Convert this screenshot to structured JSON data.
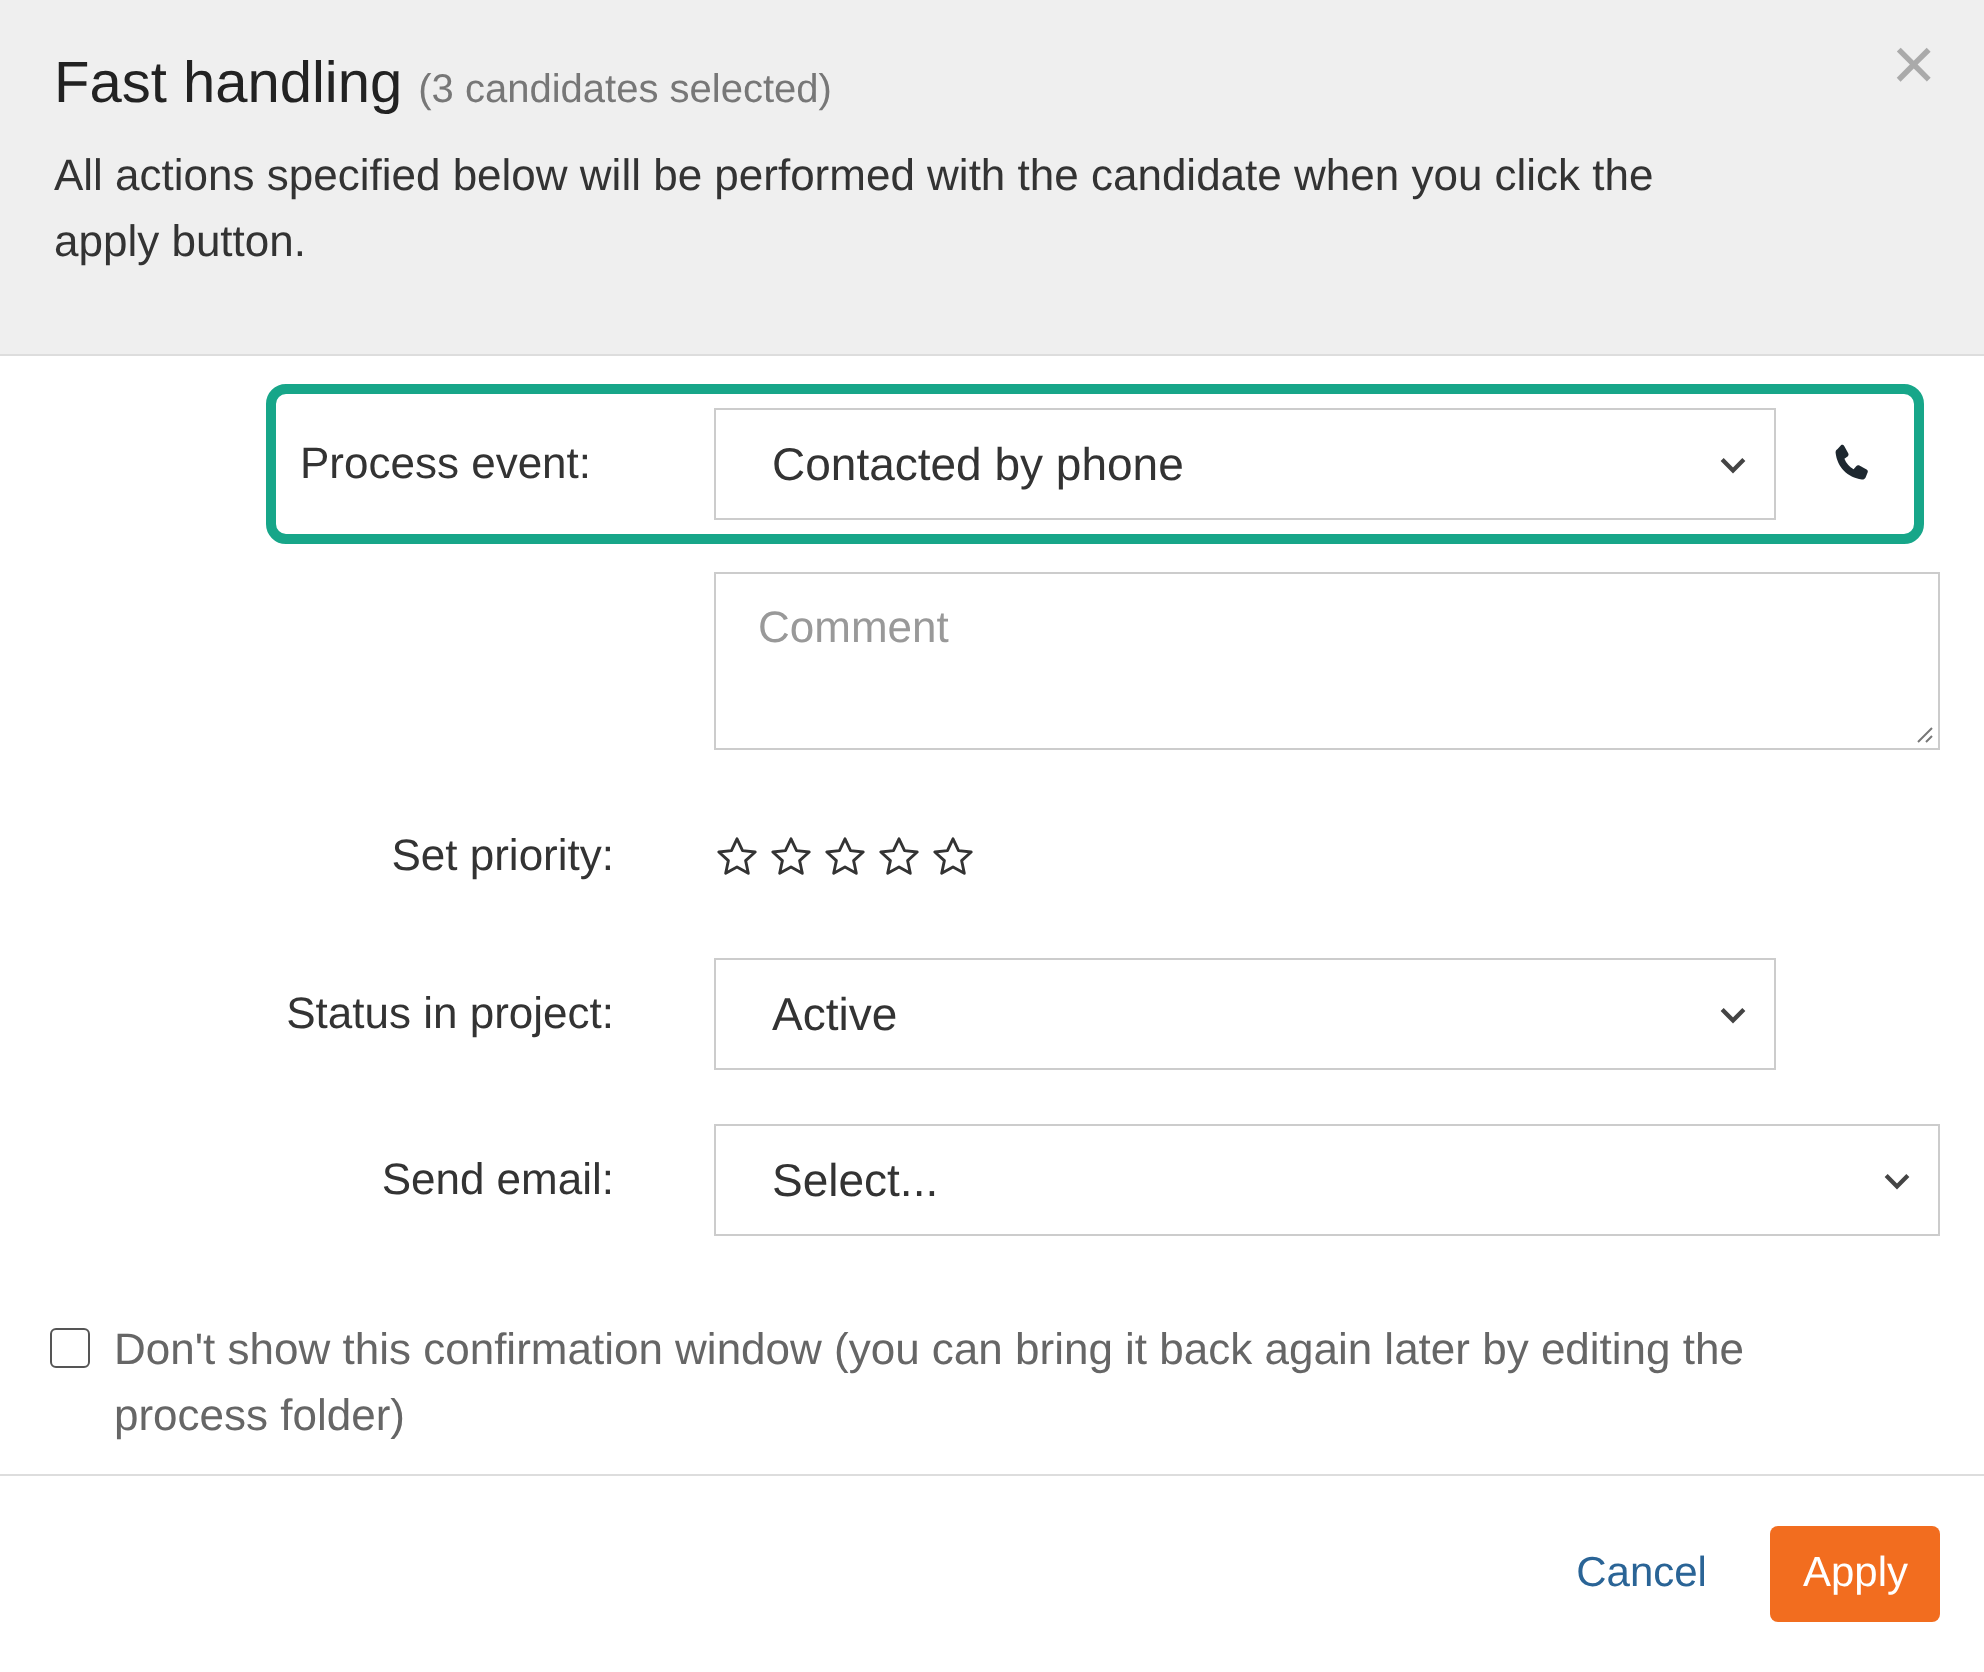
{
  "dialog": {
    "title": "Fast handling",
    "subtitle": "(3 candidates selected)",
    "description": "All actions specified below will be performed with the candidate when you click the apply button.",
    "close": "×"
  },
  "fields": [
    {
      "kind": "select",
      "label": "Process event:",
      "value": "Contacted by phone",
      "highlighted": true
    },
    {
      "kind": "textarea",
      "placeholder": "Comment"
    },
    {
      "kind": "stars",
      "label": "Set priority:",
      "stars": 0
    },
    {
      "kind": "select",
      "label": "Status in project:",
      "value": "Active",
      "highlighted": false
    },
    {
      "kind": "select",
      "label": "Send email:",
      "value": "Select...",
      "highlighted": false
    }
  ],
  "confirmation": {
    "label": "Don't show this confirmation window (you can bring it back again later by editing the process folder)",
    "checked": false
  },
  "buttons": [
    {
      "kind": "link",
      "label": "Cancel"
    },
    {
      "kind": "primary",
      "label": "Apply"
    }
  ]
}
